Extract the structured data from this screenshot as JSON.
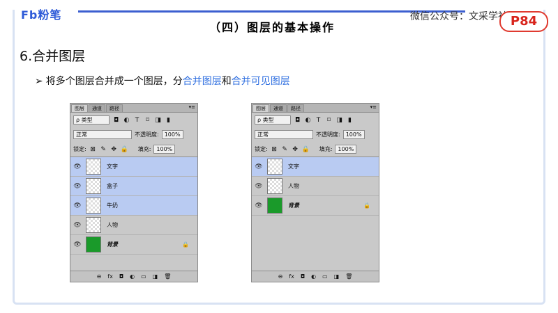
{
  "header": {
    "logo": "Fb粉笔",
    "section_title": "（四）图层的基本操作",
    "wechat": "微信公众号：文采学社",
    "page_badge": "P84"
  },
  "heading": "6.合并图层",
  "bullet": {
    "arrow": "➢",
    "prefix": "将多个图层合并成一个图层，分",
    "link1": "合并图层",
    "mid": "和",
    "link2": "合并可见图层"
  },
  "panel": {
    "tabs": [
      "图层",
      "通道",
      "路径"
    ],
    "menu": "▾≡",
    "filter": "ρ 类型",
    "blend_mode": "正常",
    "opacity_label": "不透明度:",
    "opacity_value": "100%",
    "lock_label": "锁定:",
    "fill_label": "填充:",
    "fill_value": "100%",
    "footer_icons": [
      "⊖",
      "fx",
      "◘",
      "◐",
      "▭",
      "◨",
      "🗑"
    ]
  },
  "left_layers": [
    {
      "name": "文字",
      "selected": true,
      "thumb": "checker"
    },
    {
      "name": "盒子",
      "selected": true,
      "thumb": "checker"
    },
    {
      "name": "牛奶",
      "selected": true,
      "thumb": "checker"
    },
    {
      "name": "人物",
      "selected": false,
      "thumb": "checker"
    },
    {
      "name": "背景",
      "selected": false,
      "thumb": "green",
      "locked": true
    }
  ],
  "right_layers": [
    {
      "name": "文字",
      "selected": true,
      "thumb": "checker"
    },
    {
      "name": "人物",
      "selected": false,
      "thumb": "checker"
    },
    {
      "name": "背景",
      "selected": false,
      "thumb": "green",
      "locked": true
    }
  ],
  "colors": {
    "accent": "#3c5fd0",
    "link": "#2f6fe0",
    "badge": "#d8241c",
    "selected_layer": "#b9cbf2",
    "background_layer": "#1a9a2a"
  }
}
